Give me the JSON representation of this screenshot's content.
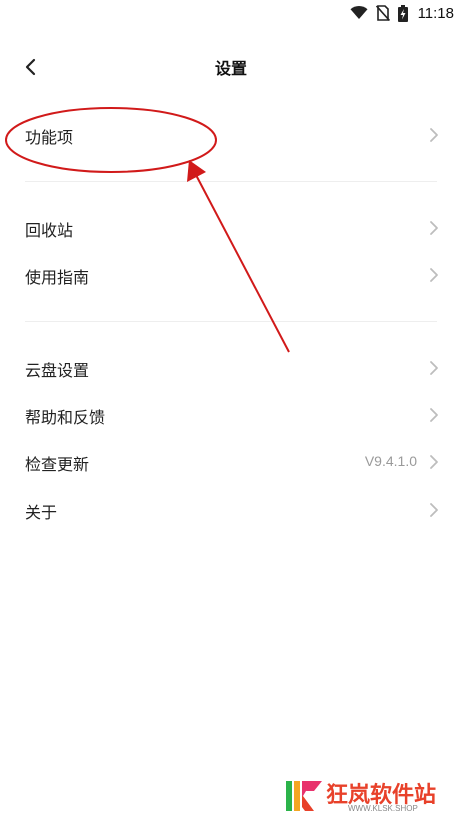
{
  "status_bar": {
    "time": "11:18",
    "icons": [
      "wifi-icon",
      "no-sim-icon",
      "battery-charging-icon"
    ]
  },
  "header": {
    "back_icon": "chevron-left-icon",
    "title": "设置"
  },
  "groups": [
    {
      "items": [
        {
          "label": "功能项",
          "value": ""
        }
      ]
    },
    {
      "items": [
        {
          "label": "回收站",
          "value": ""
        },
        {
          "label": "使用指南",
          "value": ""
        }
      ]
    },
    {
      "items": [
        {
          "label": "云盘设置",
          "value": ""
        },
        {
          "label": "帮助和反馈",
          "value": ""
        },
        {
          "label": "检查更新",
          "value": "V9.4.1.0"
        },
        {
          "label": "关于",
          "value": ""
        }
      ]
    }
  ],
  "annotation": {
    "color": "#d11a1a",
    "marks": [
      "highlight-ellipse",
      "pointer-arrow"
    ]
  },
  "watermark": {
    "title": "狂岚软件站",
    "url": "WWW.KLSK.SHOP",
    "colors": {
      "green": "#2bb34a",
      "orange": "#f5a623",
      "pink": "#e8336d",
      "red": "#e8412a"
    }
  }
}
